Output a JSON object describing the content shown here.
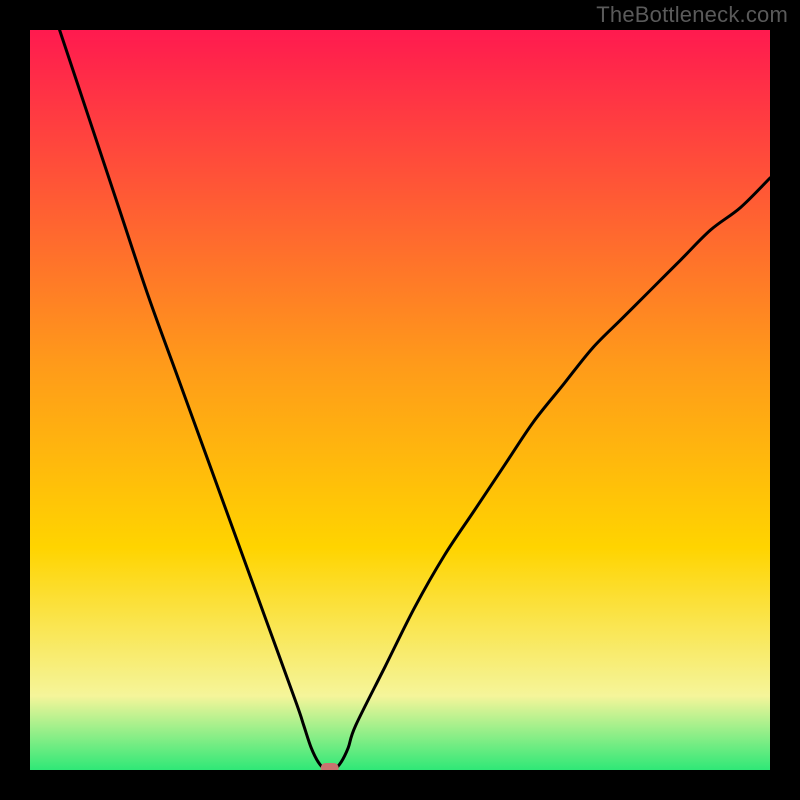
{
  "watermark": "TheBottleneck.com",
  "chart_data": {
    "type": "line",
    "title": "",
    "xlabel": "",
    "ylabel": "",
    "xlim": [
      0,
      100
    ],
    "ylim": [
      0,
      100
    ],
    "series": [
      {
        "name": "bottleneck-curve",
        "x": [
          4,
          8,
          12,
          16,
          20,
          24,
          28,
          32,
          36,
          37,
          38,
          39,
          40,
          41,
          42,
          43,
          44,
          48,
          52,
          56,
          60,
          64,
          68,
          72,
          76,
          80,
          84,
          88,
          92,
          96,
          100
        ],
        "values": [
          100,
          88,
          76,
          64,
          53,
          42,
          31,
          20,
          9,
          6,
          3,
          1,
          0,
          0,
          1,
          3,
          6,
          14,
          22,
          29,
          35,
          41,
          47,
          52,
          57,
          61,
          65,
          69,
          73,
          76,
          80
        ]
      }
    ],
    "marker": {
      "x": 40.5,
      "y": 0,
      "color": "#c9736f"
    },
    "background_gradient": {
      "top": "#ff1a4f",
      "mid": "#ffd400",
      "lower": "#f5f59a",
      "bottom": "#2fe877"
    },
    "curve_color": "#000000",
    "outer_color": "#000000"
  }
}
